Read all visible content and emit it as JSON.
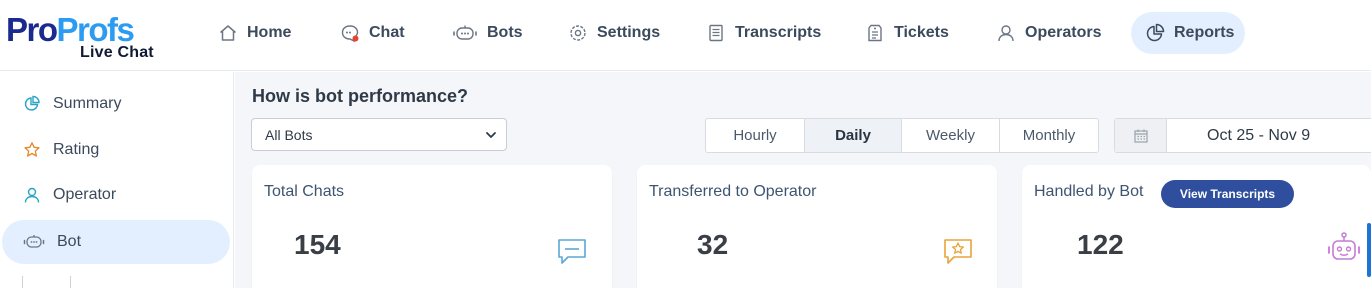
{
  "brand": {
    "logo_part1": "Pro",
    "logo_part2": "Profs",
    "logo_sub": "Live Chat"
  },
  "nav": {
    "items": [
      {
        "label": "Home",
        "icon": "home-icon"
      },
      {
        "label": "Chat",
        "icon": "chat-icon"
      },
      {
        "label": "Bots",
        "icon": "bot-icon"
      },
      {
        "label": "Settings",
        "icon": "gear-icon"
      },
      {
        "label": "Transcripts",
        "icon": "document-icon"
      },
      {
        "label": "Tickets",
        "icon": "ticket-icon"
      },
      {
        "label": "Operators",
        "icon": "user-icon"
      },
      {
        "label": "Reports",
        "icon": "pie-chart-icon",
        "active": true
      }
    ]
  },
  "sidebar": {
    "items": [
      {
        "label": "Summary",
        "icon": "pie-chart-icon"
      },
      {
        "label": "Rating",
        "icon": "star-icon"
      },
      {
        "label": "Operator",
        "icon": "user-icon"
      },
      {
        "label": "Bot",
        "icon": "bot-icon",
        "active": true
      }
    ]
  },
  "main": {
    "title": "How is bot performance?",
    "bot_filter": {
      "selected": "All Bots"
    },
    "granularity": {
      "options": [
        "Hourly",
        "Daily",
        "Weekly",
        "Monthly"
      ],
      "selected": "Daily"
    },
    "date_range": "Oct 25 - Nov 9",
    "cards": [
      {
        "title": "Total Chats",
        "value": "154",
        "icon": "message-icon"
      },
      {
        "title": "Transferred to Operator",
        "value": "32",
        "icon": "star-message-icon"
      },
      {
        "title": "Handled by Bot",
        "value": "122",
        "icon": "robot-icon",
        "button": "View Transcripts"
      }
    ]
  },
  "colors": {
    "accent": "#2f4f9e",
    "active_bg": "#e3efff",
    "brand_dark": "#1b2a8f",
    "brand_light": "#2b9cf2",
    "chat_dot": "#e8422f"
  }
}
